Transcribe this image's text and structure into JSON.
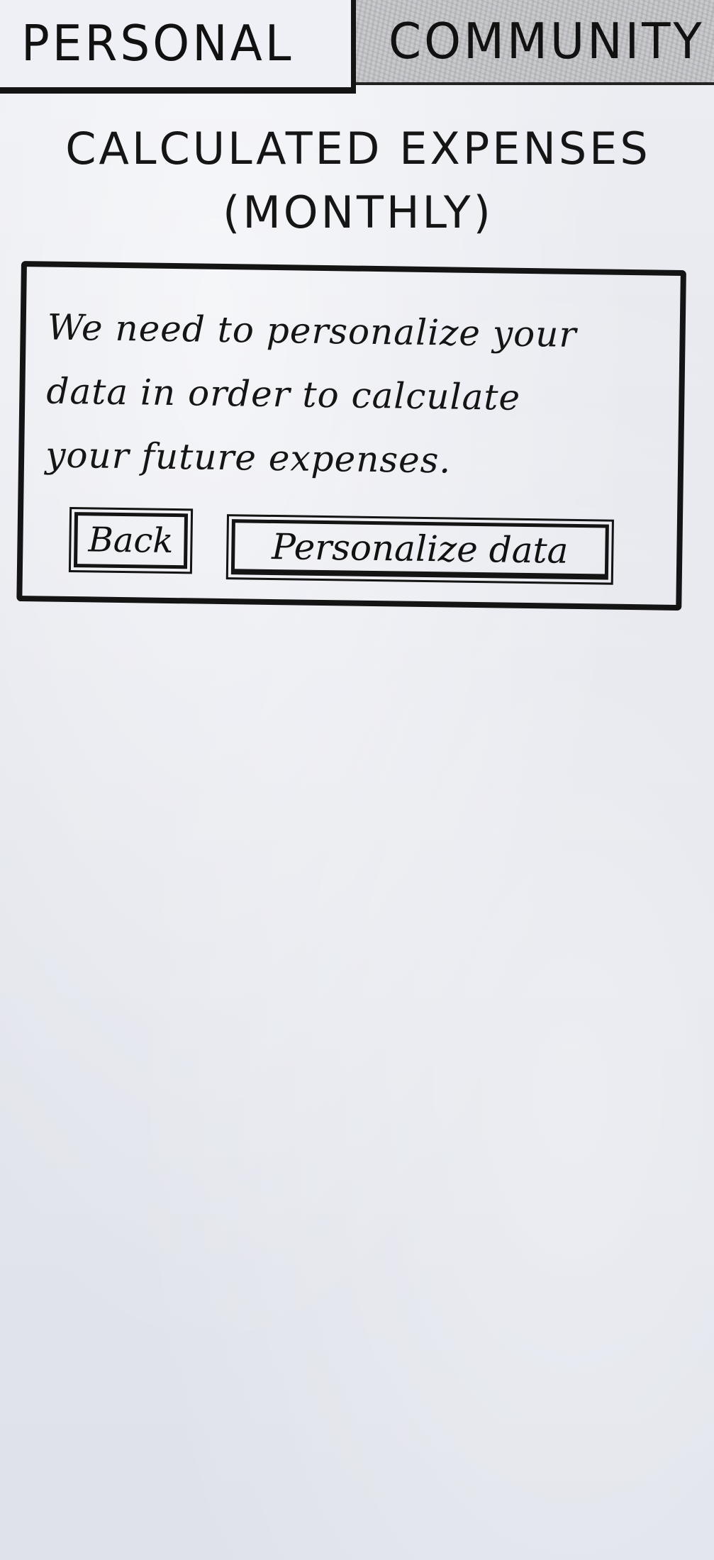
{
  "tabs": [
    {
      "label": "PERSONAL",
      "active": true
    },
    {
      "label": "COMMUNITY",
      "active": false
    }
  ],
  "page": {
    "title_line1": "CALCULATED EXPENSES",
    "title_line2": "(MONTHLY)"
  },
  "dialog": {
    "message_line1": "We need to personalize your",
    "message_line2": "data in order to calculate",
    "message_line3": "your future expenses.",
    "back_label": "Back",
    "personalize_label": "Personalize data"
  }
}
